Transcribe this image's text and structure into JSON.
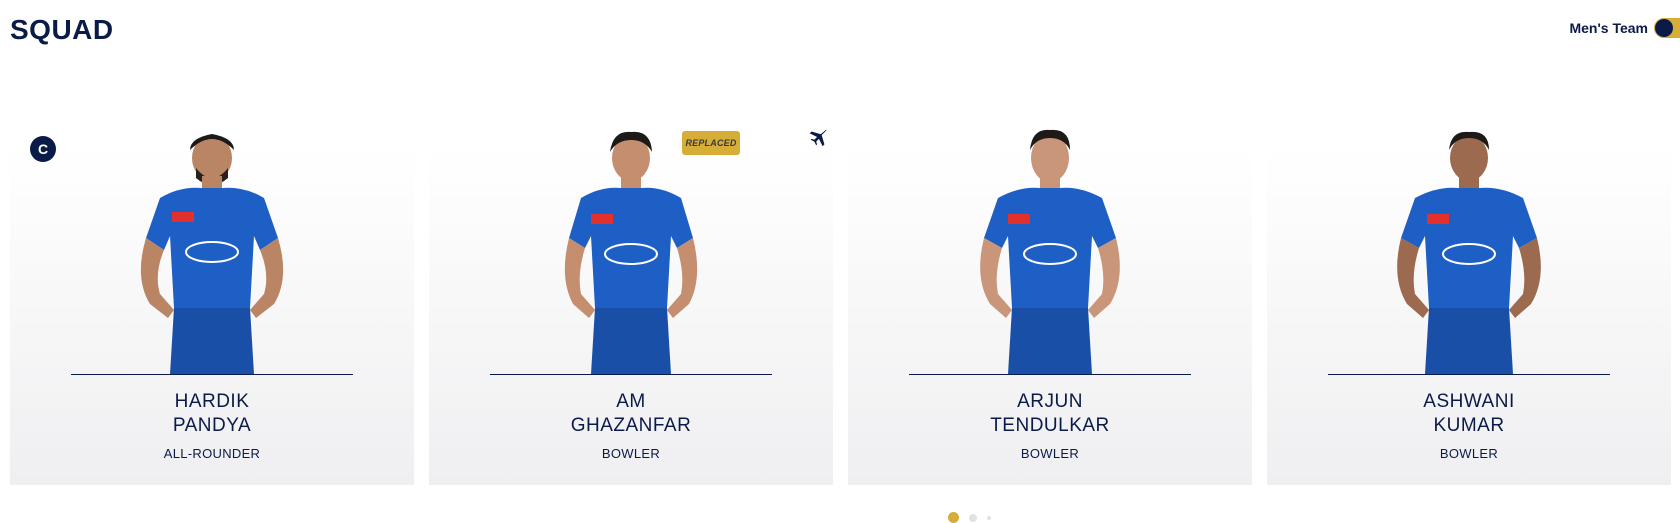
{
  "header": {
    "title": "SQUAD",
    "team_toggle_label": "Men's Team"
  },
  "colors": {
    "navy": "#0b1b48",
    "gold": "#d6ad36",
    "jersey_blue": "#1d5fc4"
  },
  "players": [
    {
      "first_name": "HARDIK",
      "last_name": "PANDYA",
      "role": "ALL-ROUNDER",
      "captain_badge": "C"
    },
    {
      "first_name": "AM",
      "last_name": "GHAZANFAR",
      "role": "BOWLER",
      "replaced_badge": "REPLACED",
      "overseas_icon": "plane-icon"
    },
    {
      "first_name": "ARJUN",
      "last_name": "TENDULKAR",
      "role": "BOWLER"
    },
    {
      "first_name": "ASHWANI",
      "last_name": "KUMAR",
      "role": "BOWLER"
    }
  ],
  "pagination": {
    "pages": 3,
    "active_page": 1
  }
}
